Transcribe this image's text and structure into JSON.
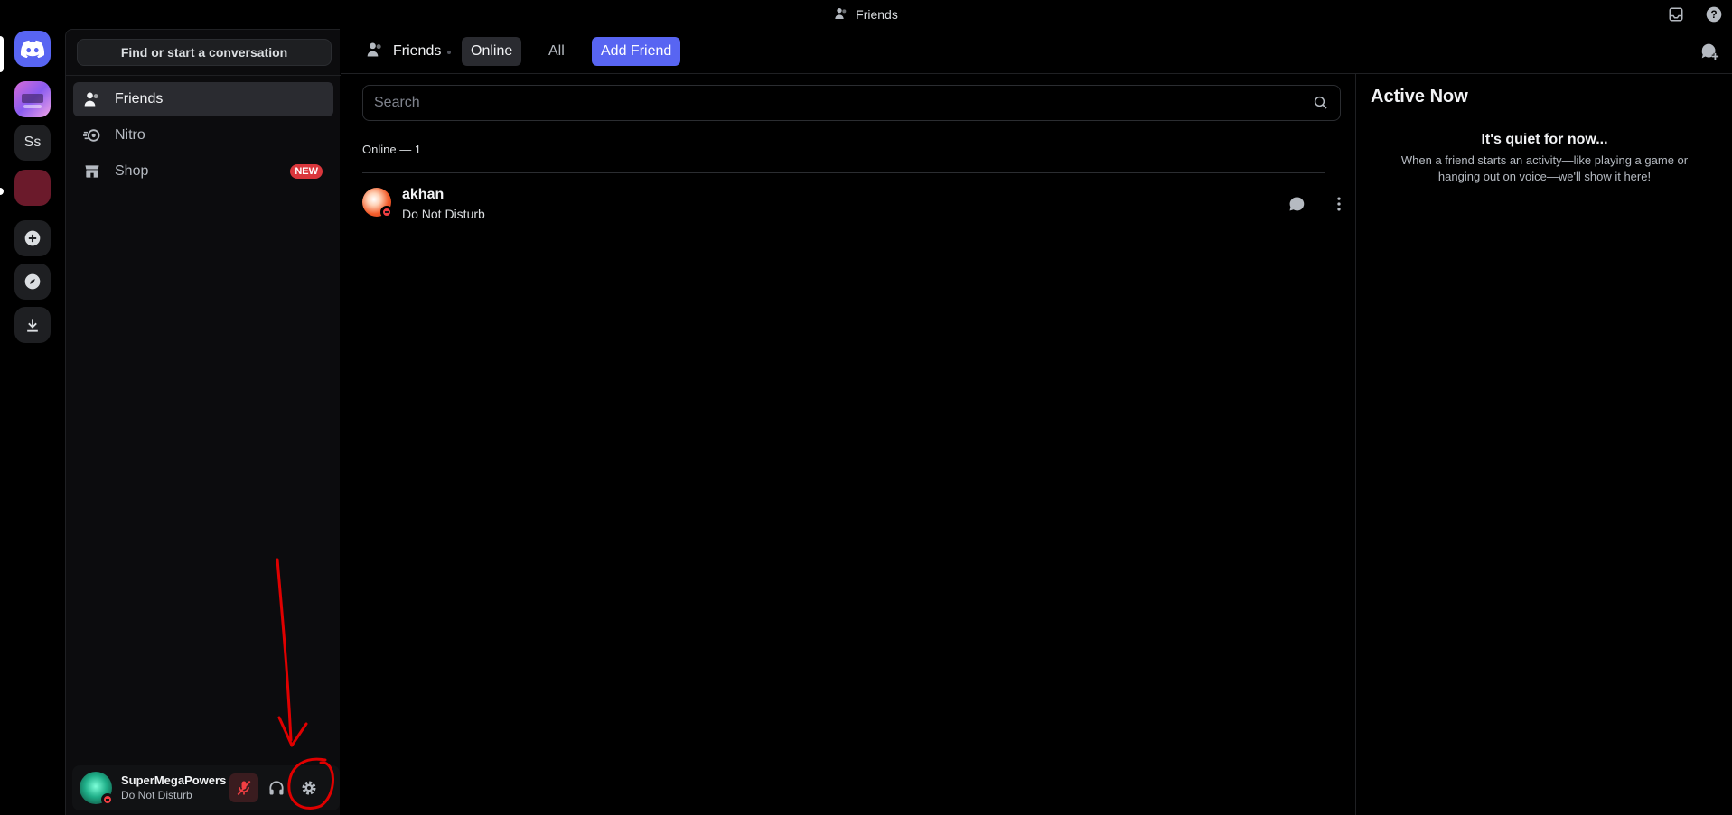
{
  "window": {
    "title": "Friends"
  },
  "rail": {
    "servers": [
      {
        "name": "home",
        "label": ""
      },
      {
        "name": "server-1",
        "label": ""
      },
      {
        "name": "server-ss",
        "label": "Ss"
      },
      {
        "name": "server-folder",
        "label": ""
      }
    ]
  },
  "sidebar": {
    "find_label": "Find or start a conversation",
    "items": [
      {
        "label": "Friends",
        "icon": "friends-icon"
      },
      {
        "label": "Nitro",
        "icon": "nitro-icon"
      },
      {
        "label": "Shop",
        "icon": "shop-icon",
        "badge": "NEW"
      }
    ]
  },
  "user": {
    "name": "SuperMegaPowers",
    "status": "Do Not Disturb"
  },
  "header": {
    "title": "Friends",
    "tabs": [
      {
        "label": "Online",
        "selected": true
      },
      {
        "label": "All",
        "selected": false
      }
    ],
    "add_friend": "Add Friend"
  },
  "search": {
    "placeholder": "Search"
  },
  "list": {
    "header": "Online — 1",
    "friends": [
      {
        "name": "akhan",
        "status": "Do Not Disturb"
      }
    ]
  },
  "active_now": {
    "title": "Active Now",
    "empty_title": "It's quiet for now...",
    "empty_desc": "When a friend starts an activity—like playing a game or hanging out on voice—we'll show it here!"
  },
  "colors": {
    "accent": "#5865f2",
    "dnd": "#f23f43",
    "annotation": "#e00000"
  }
}
